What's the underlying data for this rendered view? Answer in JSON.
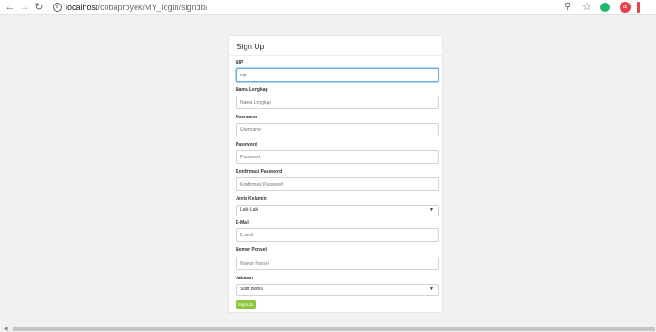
{
  "browser": {
    "url_host": "localhost",
    "url_path": "/cobaproyek/MY_login/signdb/",
    "profile_initial": "a"
  },
  "form": {
    "title": "Sign Up",
    "fields": [
      {
        "label": "NIP",
        "placeholder": "nip"
      },
      {
        "label": "Nama Lengkap",
        "placeholder": "Nama Lengkap"
      },
      {
        "label": "Username",
        "placeholder": "Username"
      },
      {
        "label": "Password",
        "placeholder": "Password"
      },
      {
        "label": "Konfirmasi Password",
        "placeholder": "Konfirmasi Password"
      }
    ],
    "gender": {
      "label": "Jenis Kelamin",
      "selected": "Laki-Laki"
    },
    "email": {
      "label": "E-Mail",
      "placeholder": "E-mail"
    },
    "phone": {
      "label": "Nomor Ponsel",
      "placeholder": "Nomor Ponsel"
    },
    "position": {
      "label": "Jabatan",
      "selected": "Staff Bisnis"
    },
    "submit_label": "Sign Up"
  },
  "colors": {
    "button": "#8dc63f",
    "focus": "#66afe9"
  }
}
